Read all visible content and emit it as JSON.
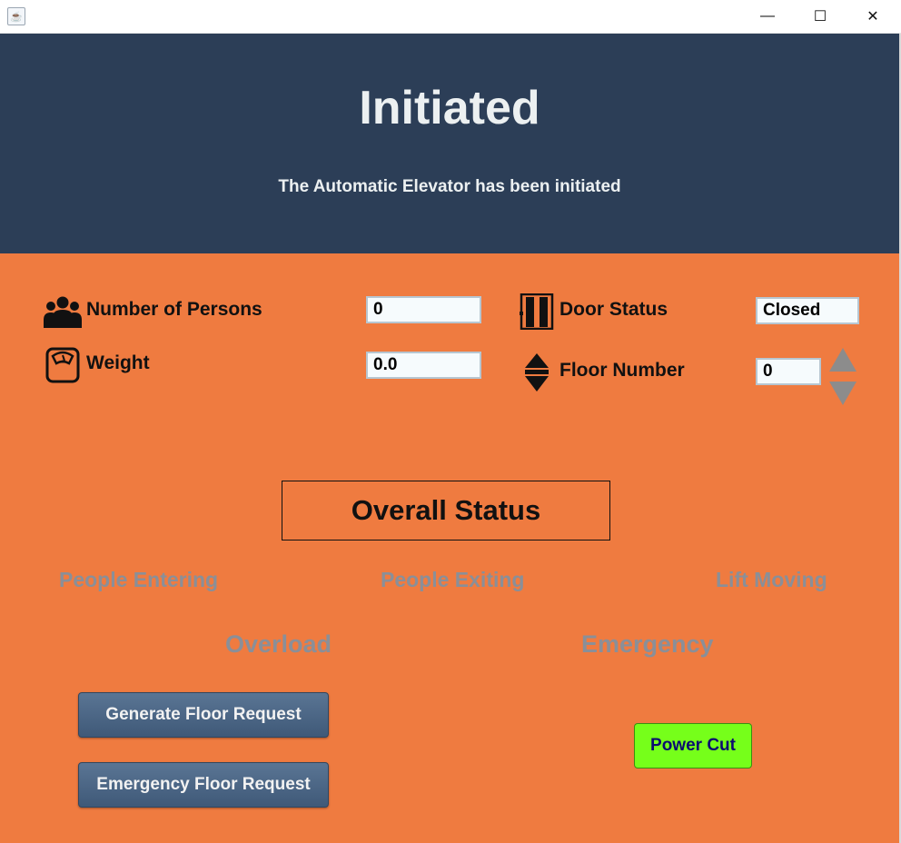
{
  "window": {
    "app_icon": "java-cup-icon",
    "minimize_glyph": "—",
    "maximize_glyph": "☐",
    "close_glyph": "✕"
  },
  "header": {
    "title": "Initiated",
    "subtitle": "The Automatic Elevator has been initiated",
    "bg_color": "#2c3e57"
  },
  "fields": {
    "persons": {
      "label": "Number of Persons",
      "value": "0",
      "icon": "people-group-icon"
    },
    "weight": {
      "label": "Weight",
      "value": "0.0",
      "icon": "scale-icon"
    },
    "door": {
      "label": "Door Status",
      "value": "Closed",
      "icon": "door-icon"
    },
    "floor": {
      "label": "Floor Number",
      "value": "0",
      "icon": "up-down-arrows-icon"
    }
  },
  "status": {
    "title": "Overall Status",
    "indicators": {
      "people_entering": "People Entering",
      "people_exiting": "People Exiting",
      "lift_moving": "Lift Moving",
      "overload": "Overload",
      "emergency": "Emergency"
    },
    "inactive_color": "#8a8f98"
  },
  "buttons": {
    "generate_floor_request": "Generate Floor Request",
    "emergency_floor_request": "Emergency Floor Request",
    "power_cut": "Power Cut"
  },
  "colors": {
    "main_bg": "#ef7b40",
    "power_cut_bg": "#76ff1a"
  }
}
